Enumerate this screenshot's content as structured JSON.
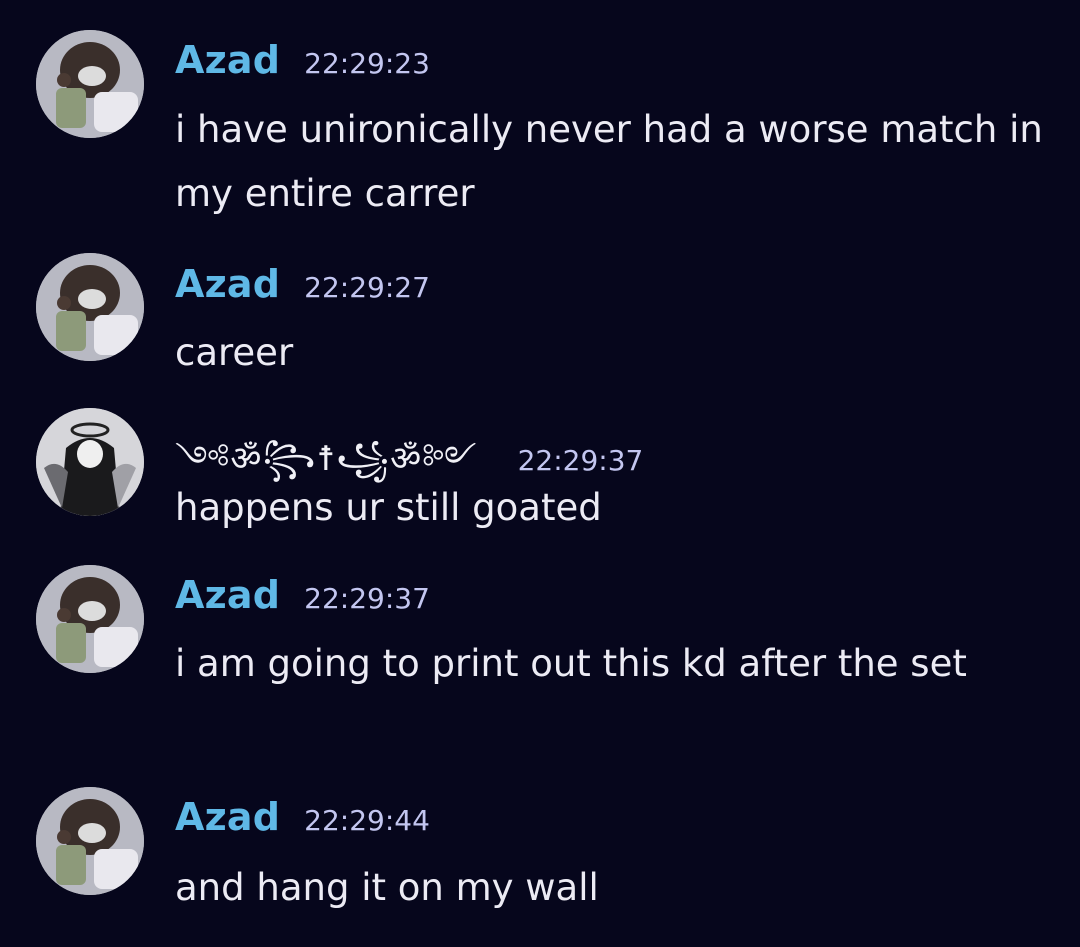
{
  "messages": [
    {
      "author": "Azad",
      "time": "22:29:23",
      "text": "i have unironically never had a worse match in my entire carrer",
      "avatar_icon": "user-avatar-icon"
    },
    {
      "author": "Azad",
      "time": "22:29:27",
      "text": "career",
      "avatar_icon": "user-avatar-icon"
    },
    {
      "author": "༺ॐ꧂☨꧁ॐ༻",
      "time": "22:29:37",
      "text": "happens ur still goated",
      "avatar_icon": "angel-avatar-icon"
    },
    {
      "author": "Azad",
      "time": "22:29:37",
      "text": "i am going to print out this kd after the set",
      "avatar_icon": "user-avatar-icon"
    },
    {
      "author": "Azad",
      "time": "22:29:44",
      "text": "and hang it on my wall",
      "avatar_icon": "user-avatar-icon"
    }
  ],
  "colors": {
    "background": "#06061c",
    "author_name": "#5fb8e6",
    "timestamp": "#c3c6f0",
    "message_text": "#ecebf4"
  }
}
